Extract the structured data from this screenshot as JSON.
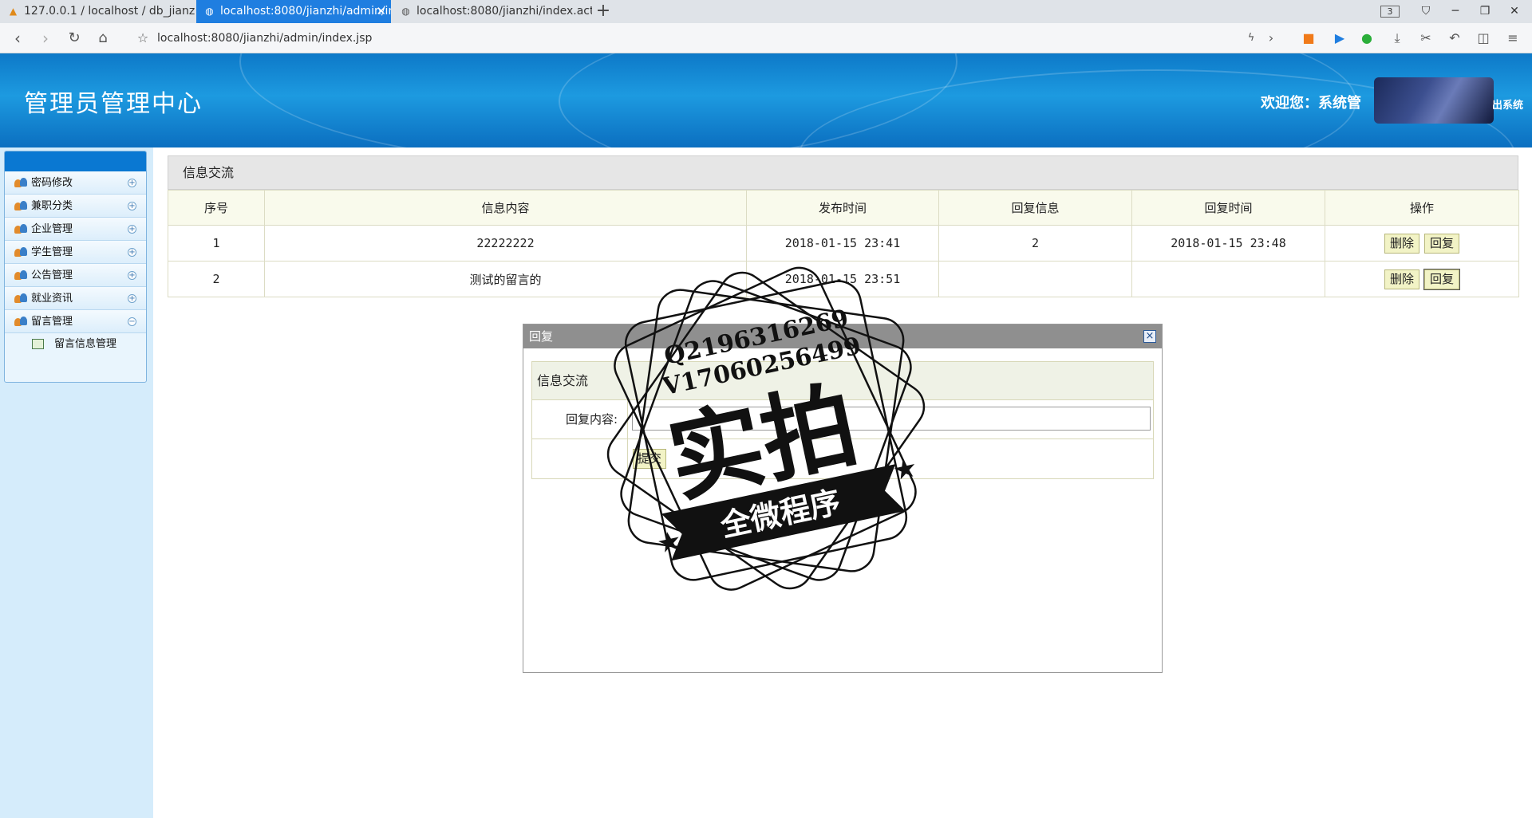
{
  "browser": {
    "tabs": [
      {
        "label": "127.0.0.1 / localhost / db_jianzhi / t",
        "active": false
      },
      {
        "label": "localhost:8080/jianzhi/admin/inde",
        "active": true
      },
      {
        "label": "localhost:8080/jianzhi/index.action",
        "active": false
      }
    ],
    "tab_count": "3",
    "url": "localhost:8080/jianzhi/admin/index.jsp",
    "accent_color": "#1f7ee0"
  },
  "header": {
    "title": "管理员管理中心",
    "welcome": "欢迎您：系统管",
    "exit_link": "出系统",
    "background_color": "#1d9ae0"
  },
  "sidebar": {
    "items": [
      {
        "label": "密码修改",
        "toggle": "+"
      },
      {
        "label": "兼职分类",
        "toggle": "+"
      },
      {
        "label": "企业管理",
        "toggle": "+"
      },
      {
        "label": "学生管理",
        "toggle": "+"
      },
      {
        "label": "公告管理",
        "toggle": "+"
      },
      {
        "label": "就业资讯",
        "toggle": "+"
      },
      {
        "label": "留言管理",
        "toggle": "−"
      }
    ],
    "subitems": [
      {
        "label": "留言信息管理"
      }
    ]
  },
  "main": {
    "panel_title": "信息交流",
    "columns": [
      "序号",
      "信息内容",
      "发布时间",
      "回复信息",
      "回复时间",
      "操作"
    ],
    "rows": [
      {
        "id": "1",
        "content": "22222222",
        "time": "2018-01-15 23:41",
        "reply": "2",
        "reply_time": "2018-01-15 23:48"
      },
      {
        "id": "2",
        "content": "测试的留言的",
        "time": "2018-01-15 23:51",
        "reply": "",
        "reply_time": ""
      }
    ],
    "delete_label": "删除",
    "reply_label": "回复"
  },
  "modal": {
    "title": "回复",
    "close_symbol": "×",
    "form_title": "信息交流",
    "field_label": "回复内容:",
    "field_value": "",
    "submit_label": "提交"
  },
  "watermark": {
    "line1": "Q2196316269",
    "line2": "V17060256499",
    "main_text": "实拍",
    "banner_text": "全微程序"
  }
}
